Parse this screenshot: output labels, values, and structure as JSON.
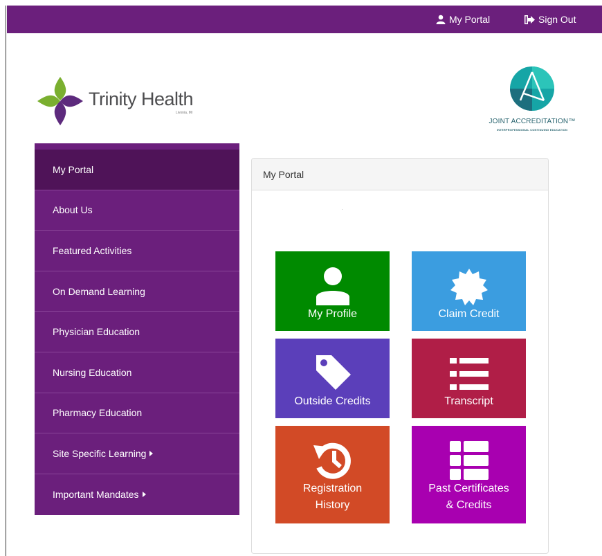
{
  "topbar": {
    "portal_label": "My Portal",
    "signout_label": "Sign Out",
    "color": "#6b1f7c"
  },
  "logo": {
    "name": "Trinity Health",
    "location": "Livonia, MI"
  },
  "accreditation": {
    "name": "JOINT ACCREDITATION",
    "tm": "™",
    "subtitle": "INTERPROFESSIONAL CONTINUING EDUCATION"
  },
  "sidebar": {
    "items": [
      {
        "label": "My Portal",
        "active": true
      },
      {
        "label": "About Us"
      },
      {
        "label": "Featured Activities"
      },
      {
        "label": "On Demand Learning"
      },
      {
        "label": "Physician Education"
      },
      {
        "label": "Nursing Education"
      },
      {
        "label": "Pharmacy Education"
      },
      {
        "label": "Site Specific Learning",
        "has_submenu": true
      },
      {
        "label": "Important Mandates",
        "has_submenu": true
      }
    ]
  },
  "panel": {
    "title": "My Portal"
  },
  "tiles": [
    {
      "line1": "My Profile",
      "icon": "user-icon",
      "color": "#008a00"
    },
    {
      "line1": "Claim Credit",
      "icon": "certificate-badge-icon",
      "color": "#3b9de0"
    },
    {
      "line1": "Outside Credits",
      "icon": "tag-icon",
      "color": "#5b3fba"
    },
    {
      "line1": "Transcript",
      "icon": "list-icon",
      "color": "#b01e47"
    },
    {
      "line1": "Registration",
      "line2": "History",
      "icon": "history-icon",
      "color": "#d24a26"
    },
    {
      "line1": "Past Certificates",
      "line2": "& Credits",
      "icon": "table-list-icon",
      "color": "#a800b0"
    }
  ]
}
